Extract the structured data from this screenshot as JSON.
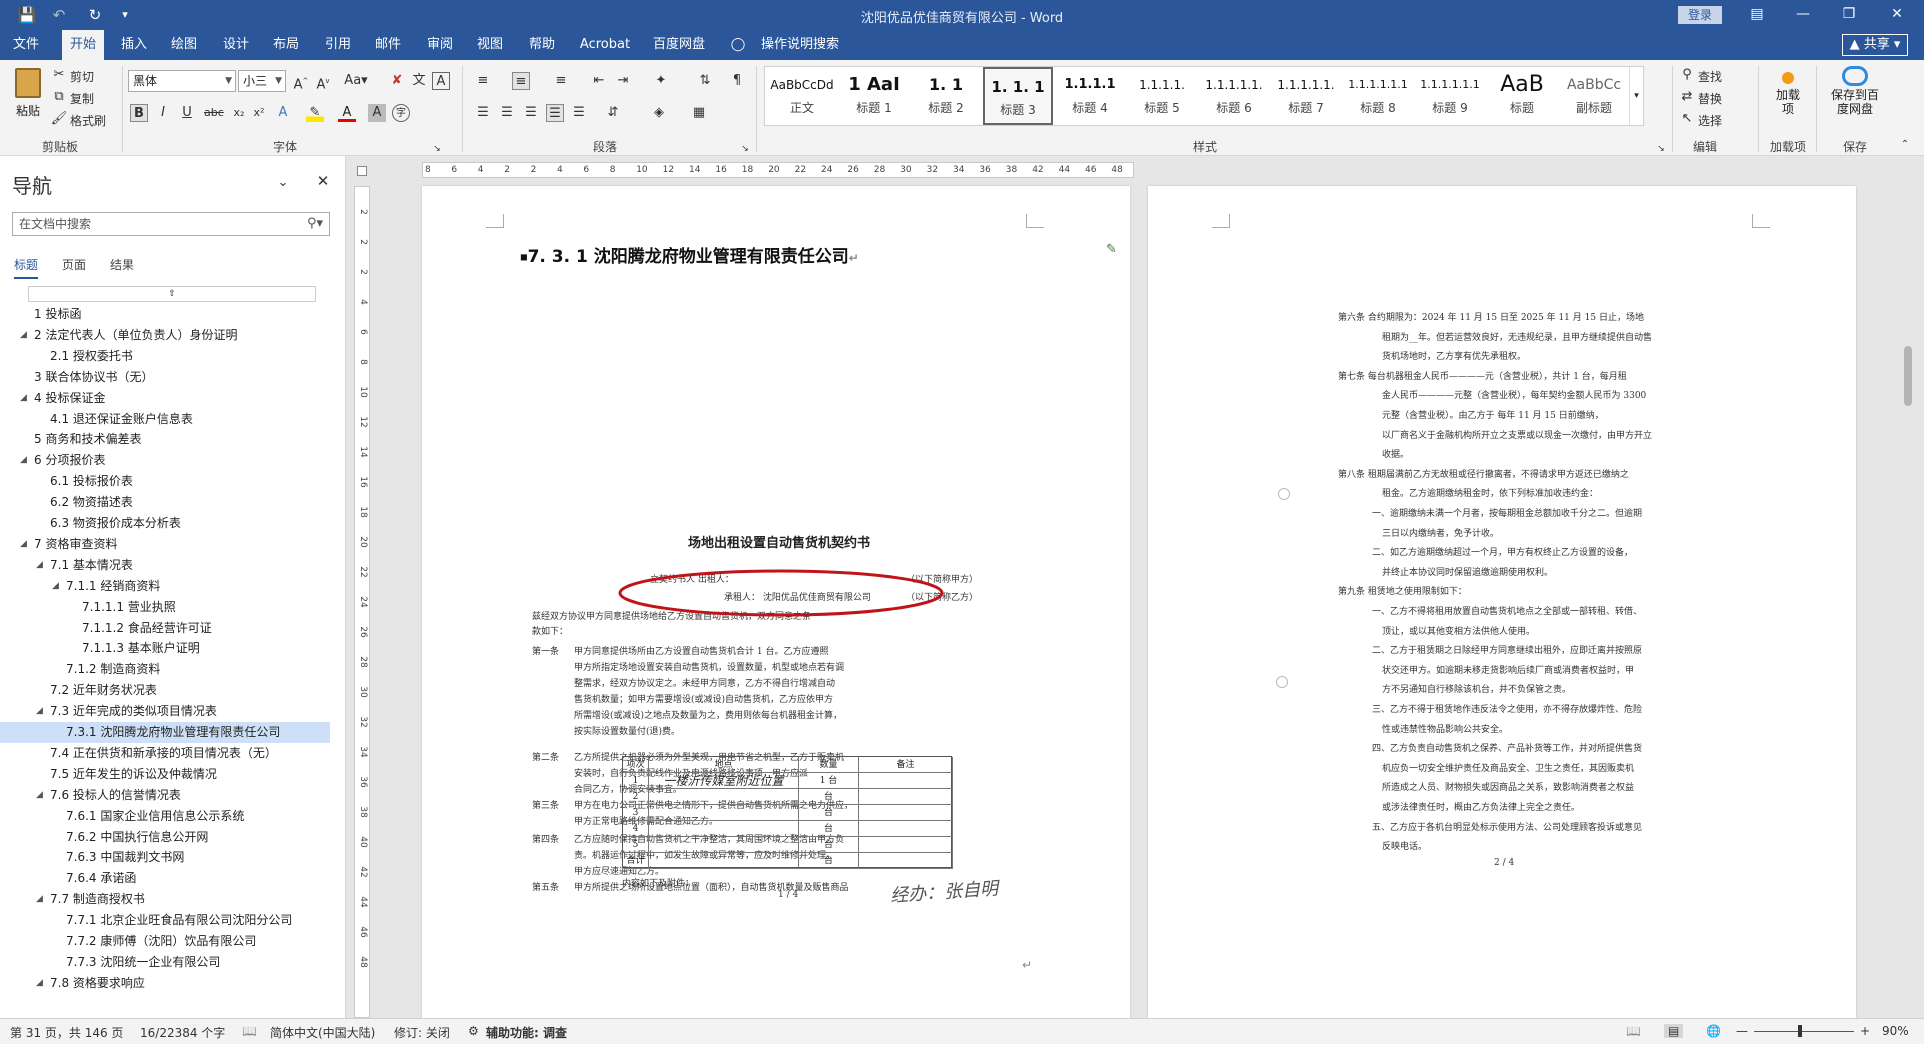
{
  "titlebar": {
    "title": "沈阳优品优佳商贸有限公司  -  Word",
    "login": "登录",
    "save_icon": "save-icon",
    "undo_icon": "undo-icon",
    "redo_icon": "redo-icon",
    "customize": "▾"
  },
  "tabs": [
    "文件",
    "开始",
    "插入",
    "绘图",
    "设计",
    "布局",
    "引用",
    "邮件",
    "审阅",
    "视图",
    "帮助",
    "Acrobat",
    "百度网盘",
    "操作说明搜索"
  ],
  "active_tab": "开始",
  "share": "共享",
  "ribbon": {
    "clipboard": {
      "paste": "粘贴",
      "cut": "剪切",
      "copy": "复制",
      "format_painter": "格式刷",
      "label": "剪贴板"
    },
    "font": {
      "family": "黑体",
      "size": "小三",
      "label": "字体",
      "aa": "Aa"
    },
    "paragraph": {
      "label": "段落"
    },
    "styles": {
      "label": "样式",
      "items": [
        {
          "preview": "AaBbCcDd",
          "name": "正文"
        },
        {
          "preview": "1  AaI",
          "name": "标题 1"
        },
        {
          "preview": "1. 1",
          "name": "标题 2"
        },
        {
          "preview": "1. 1. 1",
          "name": "标题 3"
        },
        {
          "preview": "1.1.1.1",
          "name": "标题 4"
        },
        {
          "preview": "1.1.1.1.",
          "name": "标题 5"
        },
        {
          "preview": "1.1.1.1.1.",
          "name": "标题 6"
        },
        {
          "preview": "1.1.1.1.1.",
          "name": "标题 7"
        },
        {
          "preview": "1.1.1.1.1.1",
          "name": "标题 8"
        },
        {
          "preview": "1.1.1.1.1.1",
          "name": "标题 9"
        },
        {
          "preview": "AaB",
          "name": "标题"
        },
        {
          "preview": "AaBbCc",
          "name": "副标题"
        }
      ],
      "selected": 3
    },
    "editing": {
      "find": "查找",
      "replace": "替换",
      "select": "选择",
      "label": "编辑"
    },
    "addins": {
      "btn": "加载项",
      "label": "加载项"
    },
    "save": {
      "btn": "保存到百度网盘",
      "label": "保存"
    }
  },
  "nav": {
    "title": "导航",
    "search_placeholder": "在文档中搜索",
    "tabs": [
      "标题",
      "页面",
      "结果"
    ],
    "items": [
      {
        "text": "1 投标函",
        "level": 1,
        "arrow": false
      },
      {
        "text": "2 法定代表人（单位负责人）身份证明",
        "level": 1,
        "arrow": true
      },
      {
        "text": "2.1 授权委托书",
        "level": 2,
        "arrow": false
      },
      {
        "text": "3 联合体协议书（无）",
        "level": 1,
        "arrow": false
      },
      {
        "text": "4 投标保证金",
        "level": 1,
        "arrow": true
      },
      {
        "text": "4.1 退还保证金账户信息表",
        "level": 2,
        "arrow": false
      },
      {
        "text": "5 商务和技术偏差表",
        "level": 1,
        "arrow": false
      },
      {
        "text": "6 分项报价表",
        "level": 1,
        "arrow": true
      },
      {
        "text": "6.1 投标报价表",
        "level": 2,
        "arrow": false
      },
      {
        "text": "6.2 物资描述表",
        "level": 2,
        "arrow": false
      },
      {
        "text": "6.3 物资报价成本分析表",
        "level": 2,
        "arrow": false
      },
      {
        "text": "7 资格审查资料",
        "level": 1,
        "arrow": true
      },
      {
        "text": "7.1 基本情况表",
        "level": 2,
        "arrow": true
      },
      {
        "text": "7.1.1 经销商资料",
        "level": 3,
        "arrow": true
      },
      {
        "text": "7.1.1.1 营业执照",
        "level": 4,
        "arrow": false
      },
      {
        "text": "7.1.1.2 食品经营许可证",
        "level": 4,
        "arrow": false
      },
      {
        "text": "7.1.1.3 基本账户证明",
        "level": 4,
        "arrow": false
      },
      {
        "text": "7.1.2 制造商资料",
        "level": 3,
        "arrow": false
      },
      {
        "text": "7.2 近年财务状况表",
        "level": 2,
        "arrow": false
      },
      {
        "text": "7.3 近年完成的类似项目情况表",
        "level": 2,
        "arrow": true
      },
      {
        "text": "7.3.1 沈阳腾龙府物业管理有限责任公司",
        "level": 3,
        "arrow": false,
        "selected": true
      },
      {
        "text": "7.4 正在供货和新承接的项目情况表（无）",
        "level": 2,
        "arrow": false
      },
      {
        "text": "7.5 近年发生的诉讼及仲裁情况",
        "level": 2,
        "arrow": false
      },
      {
        "text": "7.6 投标人的信誉情况表",
        "level": 2,
        "arrow": true
      },
      {
        "text": "7.6.1 国家企业信用信息公示系统",
        "level": 3,
        "arrow": false
      },
      {
        "text": "7.6.2 中国执行信息公开网",
        "level": 3,
        "arrow": false
      },
      {
        "text": "7.6.3 中国裁判文书网",
        "level": 3,
        "arrow": false
      },
      {
        "text": "7.6.4 承诺函",
        "level": 3,
        "arrow": false
      },
      {
        "text": "7.7 制造商授权书",
        "level": 2,
        "arrow": true
      },
      {
        "text": "7.7.1 北京企业旺食品有限公司沈阳分公司",
        "level": 3,
        "arrow": false
      },
      {
        "text": "7.7.2 康师傅（沈阳）饮品有限公司",
        "level": 3,
        "arrow": false
      },
      {
        "text": "7.7.3 沈阳统一企业有限公司",
        "level": 3,
        "arrow": false
      },
      {
        "text": "7.8 资格要求响应",
        "level": 2,
        "arrow": true
      }
    ]
  },
  "ruler": {
    "h": [
      "8",
      "6",
      "4",
      "2",
      "2",
      "4",
      "6",
      "8",
      "10",
      "12",
      "14",
      "16",
      "18",
      "20",
      "22",
      "24",
      "26",
      "28",
      "30",
      "32",
      "34",
      "36",
      "38",
      "42",
      "44",
      "46",
      "48"
    ],
    "v": [
      "2",
      "2",
      "2",
      "4",
      "6",
      "8",
      "10",
      "12",
      "14",
      "16",
      "18",
      "20",
      "22",
      "24",
      "26",
      "28",
      "30",
      "32",
      "34",
      "36",
      "38",
      "40",
      "42",
      "44",
      "46",
      "48"
    ]
  },
  "doc": {
    "heading": "7. 3. 1 沈阳腾龙府物业管理有限责任公司",
    "contract_title": "场地出租设置自动售货机契约书",
    "party_a": "立契约书人   出租人：",
    "party_a_note": "（以下简称甲方）",
    "party_b": "承租人：  沈阳优品优佳商贸有限公司",
    "party_b_note": "（以下简称乙方）",
    "intro": "兹经双方协议甲方同意提供场地给乙方设置自动售货机，双方同意之条",
    "intro2": "款如下：",
    "art1_head": "第一条",
    "art1": [
      "甲方同意提供场所由乙方设置自动售货机合计  1  台。乙方应遵照",
      "甲方所指定场地设置安装自动售货机，设置数量，机型或地点若有调",
      "整需求，经双方协议定之。未经甲方同意，乙方不得自行增减自动",
      "售货机数量；如甲方需要增设(或减设)自动售货机，乙方应依甲方",
      "所需增设(或减设)之地点及数量为之，费用则依每台机器租金计算，",
      "按实际设置数量付(退)费。"
    ],
    "art2_head": "第二条",
    "art2": [
      "乙方所提供之机器必须为外型美观，用电节省之机型，乙方于贩卖机",
      "安装时，自行负责配线作业及电源线路移设事项，甲方应派",
      "合同乙方，协调安装事宜。"
    ],
    "art3_head": "第三条",
    "art3": [
      "甲方在电力公司正常供电之情形下，提供自动售货机所需之电力供应，",
      "甲方正常电路维修需配合通知乙方。"
    ],
    "art4_head": "第四条",
    "art4": [
      "乙方应随时保持自动售货机之干净整洁，其周围环境之整洁由甲方负",
      "责。机器运作过程中，如发生故障或异常等，应及时维修并处理，",
      "甲方应尽速通知乙方。"
    ],
    "art5_head": "第五条",
    "art5": [
      "甲方所提供之场所设置地点位置（面积），自动售货机数量及贩售商品"
    ],
    "table_headers": [
      "项次",
      "地点",
      "数量",
      "备注"
    ],
    "table_rows": [
      [
        "1",
        "一楼沂传媒室附近位置",
        "1  台",
        ""
      ],
      [
        "2",
        "",
        "台",
        ""
      ],
      [
        "3",
        "",
        "台",
        ""
      ],
      [
        "4",
        "",
        "台",
        ""
      ],
      [
        "5",
        "",
        "台",
        ""
      ],
      [
        "合计",
        "",
        "台",
        ""
      ]
    ],
    "after_table": "内容如下及附件：",
    "page1_num": "1 / 4",
    "sign": "经办：张自明",
    "p2": [
      "第六条  合约期限为：2024 年 11 月 15 日至 2025 年 11 月 15 日止，场地",
      "租期为__年。但若运营效良好，无违规纪录，且甲方继续提供自动售",
      "货机场地时，乙方享有优先承租权。",
      "第七条  每台机器租金人民币————元（含营业税），共计  1  台，每月租",
      "金人民币————元整（含营业税），每年契约金额人民币为  3300",
      "元整（含营业税）。由乙方于          每年  11  月  15  日前缴纳，",
      "以厂商名义于金融机构所开立之支票或以现金一次缴付，由甲方开立",
      "收据。",
      "第八条  租期届满前乙方无故租或径行撤离者，不得请求甲方返还已缴纳之",
      "租金。乙方逾期缴纳租金时，依下列标准加收违约金：",
      "一、逾期缴纳未满一个月者，按每期租金总额加收千分之二。但逾期",
      "三日以内缴纳者，免予计收。",
      "二、如乙方逾期缴纳超过一个月，甲方有权终止乙方设置的设备，",
      "并终止本协议同时保留追缴逾期使用权利。",
      "第九条  租赁地之使用限制如下：",
      "一、乙方不得将租用放置自动售货机地点之全部或一部转租、转借、",
      "顶让，或以其他变相方法供他人使用。",
      "二、乙方于租赁期之日除经甲方同意继续出租外，应即迁离并按照原",
      "状交还甲方。如逾期未移走货影响后续厂商或消费者权益时，甲",
      "方不另通知自行移除该机台，并不负保管之责。",
      "三、乙方不得于租赁地作违反法令之使用，亦不得存放爆炸性、危险",
      "性或违禁性物品影响公共安全。",
      "四、乙方负责自动售货机之保养、产品补货等工作，并对所提供售货",
      "机应负一切安全维护责任及商品安全、卫生之责任，其因贩卖机",
      "所造成之人员、财物损失或因商品之关系，致影响消费者之权益",
      "或涉法律责任时，概由乙方负法律上完全之责任。",
      "五、乙方应于各机台明显处标示使用方法、公司处理顾客投诉或意见",
      "反映电话。"
    ],
    "page2_num": "2 / 4"
  },
  "status": {
    "page": "第 31 页，共 146 页",
    "words": "16/22384 个字",
    "lang": "简体中文(中国大陆)",
    "track": "修订: 关闭",
    "access": "辅助功能: 调查",
    "zoom": "90%"
  }
}
